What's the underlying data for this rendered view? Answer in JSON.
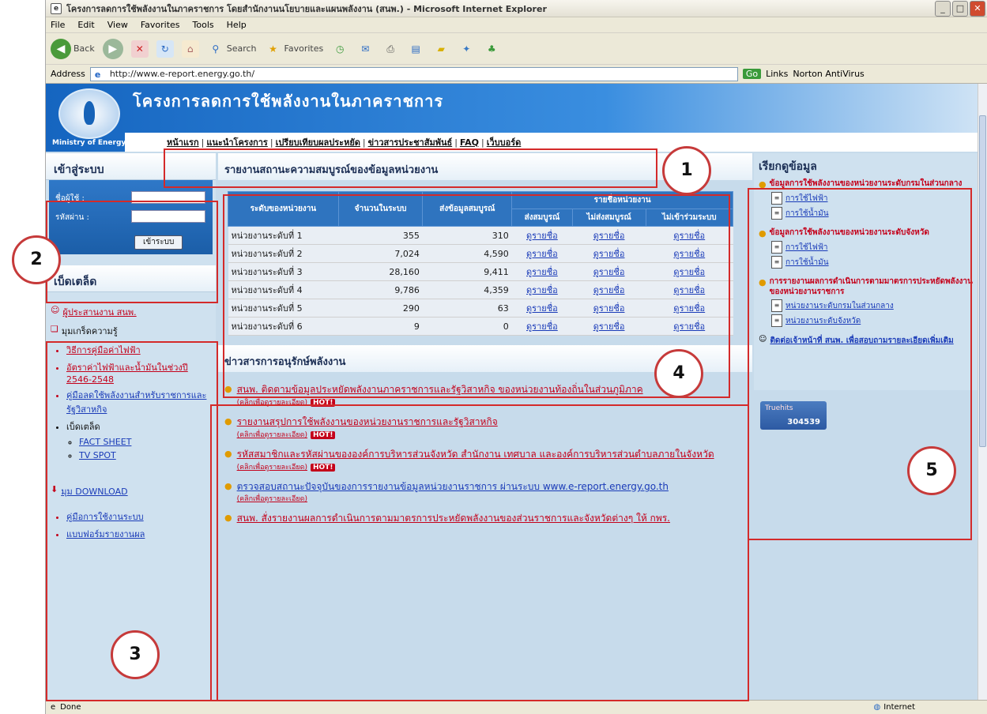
{
  "window": {
    "title": "โครงการลดการใช้พลังงานในภาคราชการ โดยสำนักงานนโยบายและแผนพลังงาน (สนพ.) - Microsoft Internet Explorer",
    "buttons": {
      "minimize": "_",
      "maximize": "□",
      "close": "✕"
    }
  },
  "menu": [
    "File",
    "Edit",
    "View",
    "Favorites",
    "Tools",
    "Help"
  ],
  "toolbar": {
    "back": "Back",
    "search": "Search",
    "favorites": "Favorites"
  },
  "address": {
    "label": "Address",
    "url": "http://www.e-report.energy.go.th/",
    "go": "Go",
    "links": "Links",
    "norton": "Norton AntiVirus"
  },
  "banner": {
    "title": "โครงการลดการใช้พลังงานในภาคราชการ",
    "ministry": "Ministry of Energy"
  },
  "nav": [
    "หน้าแรก",
    "แนะนำโครงการ",
    "เปรียบเทียบผลประหยัด",
    "ข่าวสารประชาสัมพันธ์",
    "FAQ",
    "เว็บบอร์ด"
  ],
  "login": {
    "heading": "เข้าสู่ระบบ",
    "user_label": "ชื่อผู้ใช้ :",
    "pass_label": "รหัสผ่าน :",
    "button": "เข้าระบบ"
  },
  "left": {
    "heading": "เบ็ดเตล็ด",
    "item1": "ผู้ประสานงาน สนพ.",
    "item2": "มุมเกร็ดความรู้",
    "knowledge": [
      "วิธีการคู่มือค่าไฟฟ้า",
      "อัตราค่าไฟฟ้าและน้ำมันในช่วงปี 2546-2548",
      "คู่มือลดใช้พลังงานสำหรับราชการและรัฐวิสาหกิจ",
      "เบ็ดเตล็ด"
    ],
    "media": [
      "FACT SHEET",
      "TV SPOT"
    ],
    "download": "มุม DOWNLOAD",
    "download_items": [
      "คู่มือการใช้งานระบบ",
      "แบบฟอร์มรายงานผล"
    ]
  },
  "report": {
    "title": "รายงานสถานะความสมบูรณ์ของข้อมูลหน่วยงาน",
    "headers": {
      "level": "ระดับของหน่วยงาน",
      "count": "จำนวนในระบบ",
      "sent": "ส่งข้อมูลสมบูรณ์",
      "group": "รายชื่อหน่วยงาน",
      "complete": "ส่งสมบูรณ์",
      "incomplete": "ไม่ส่งสมบูรณ์",
      "notjoined": "ไม่เข้าร่วมระบบ"
    },
    "view": "ดูรายชื่อ",
    "rows": [
      {
        "level": "หน่วยงานระดับที่ 1",
        "count": "355",
        "sent": "310"
      },
      {
        "level": "หน่วยงานระดับที่ 2",
        "count": "7,024",
        "sent": "4,590"
      },
      {
        "level": "หน่วยงานระดับที่ 3",
        "count": "28,160",
        "sent": "9,411"
      },
      {
        "level": "หน่วยงานระดับที่ 4",
        "count": "9,786",
        "sent": "4,359"
      },
      {
        "level": "หน่วยงานระดับที่ 5",
        "count": "290",
        "sent": "63"
      },
      {
        "level": "หน่วยงานระดับที่ 6",
        "count": "9",
        "sent": "0"
      }
    ]
  },
  "news": {
    "title": "ข่าวสารการอนุรักษ์พลังงาน",
    "more": "(คลิกเพื่อดูรายละเอียด)",
    "hot": "HOT!",
    "items": [
      "สนพ. ติดตามข้อมูลประหยัดพลังงานภาคราชการและรัฐวิสาหกิจ ของหน่วยงานท้องถิ่นในส่วนภูมิภาค",
      "รายงานสรุปการใช้พลังงานของหน่วยงานราชการและรัฐวิสาหกิจ",
      "รหัสสมาชิกและรหัสผ่านขององค์การบริหารส่วนจังหวัด สำนักงาน เทศบาล และองค์การบริหารส่วนตำบลภายในจังหวัด",
      "ตรวจสอบสถานะปัจจุบันของการรายงานข้อมูลหน่วยงานราชการ ผ่านระบบ www.e-report.energy.go.th",
      "สนพ. สั่งรายงานผลการดำเนินการตามมาตรการประหยัดพลังงานของส่วนราชการและจังหวัดต่างๆ ให้ กพร."
    ]
  },
  "right": {
    "heading": "เรียกดูข้อมูล",
    "sec1": "ข้อมูลการใช้พลังงานของหน่วยงานระดับกรมในส่วนกลาง",
    "sec2": "ข้อมูลการใช้พลังงานของหน่วยงานระดับจังหวัด",
    "sec3": "การรายงานผลการดำเนินการตามมาตรการประหยัดพลังงานของหน่วยงานราชการ",
    "power": "การใช้ไฟฟ้า",
    "fuel": "การใช้น้ำมัน",
    "central": "หน่วยงานระดับกรมในส่วนกลาง",
    "province": "หน่วยงานระดับจังหวัด",
    "contact": "ติดต่อเจ้าหน้าที่ สนพ. เพื่อสอบถามรายละเอียดเพิ่มเติม",
    "counter_label": "Truehits",
    "counter": "304539"
  },
  "status": {
    "left": "Done",
    "right": "Internet"
  },
  "callouts": [
    "1",
    "2",
    "3",
    "4",
    "5"
  ]
}
